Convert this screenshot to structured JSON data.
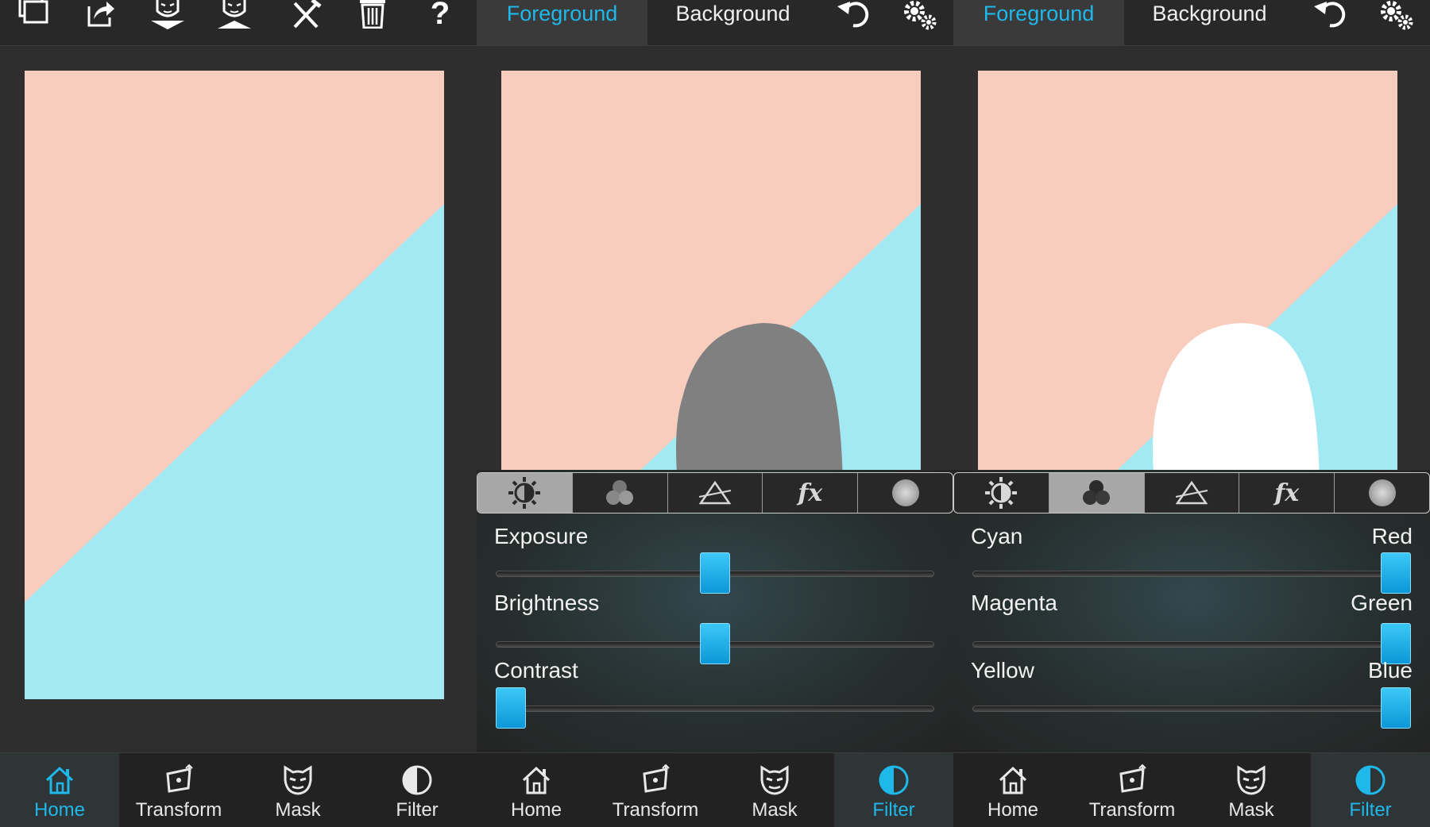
{
  "colors": {
    "accent": "#1fb8ea",
    "canvas_peach": "#f8cdbe",
    "canvas_cyan": "#a3e9f4",
    "silhouette_gray": "#808080",
    "silhouette_white": "#ffffff"
  },
  "toolbar_icons": [
    "layers-icon",
    "share-icon",
    "import-face-icon",
    "export-face-icon",
    "tools-icon",
    "trash-icon",
    "help-icon"
  ],
  "help_glyph": "?",
  "panels": [
    {
      "nav": [
        {
          "label": "Home",
          "icon": "home-icon",
          "active": true
        },
        {
          "label": "Transform",
          "icon": "transform-icon",
          "active": false
        },
        {
          "label": "Mask",
          "icon": "mask-icon",
          "active": false
        },
        {
          "label": "Filter",
          "icon": "filter-icon",
          "active": false
        }
      ]
    },
    {
      "tabs": {
        "foreground": "Foreground",
        "background": "Background",
        "active": "foreground"
      },
      "filter_tabs": [
        "brightness-icon",
        "color-balance-icon",
        "prism-icon",
        "fx-icon",
        "circle-icon"
      ],
      "fx_label": "fx",
      "selected_filter_tab": 0,
      "sliders": [
        {
          "label": "Exposure",
          "value": 0.5
        },
        {
          "label": "Brightness",
          "value": 0.5
        },
        {
          "label": "Contrast",
          "value": 0.0
        }
      ],
      "nav": [
        {
          "label": "Home",
          "icon": "home-icon",
          "active": false
        },
        {
          "label": "Transform",
          "icon": "transform-icon",
          "active": false
        },
        {
          "label": "Mask",
          "icon": "mask-icon",
          "active": false
        },
        {
          "label": "Filter",
          "icon": "filter-icon",
          "active": true
        }
      ]
    },
    {
      "tabs": {
        "foreground": "Foreground",
        "background": "Background",
        "active": "foreground"
      },
      "filter_tabs": [
        "brightness-icon",
        "color-balance-icon",
        "prism-icon",
        "fx-icon",
        "circle-icon"
      ],
      "fx_label": "fx",
      "selected_filter_tab": 1,
      "sliders": [
        {
          "left": "Cyan",
          "right": "Red",
          "value": 1.0
        },
        {
          "left": "Magenta",
          "right": "Green",
          "value": 1.0
        },
        {
          "left": "Yellow",
          "right": "Blue",
          "value": 1.0
        }
      ],
      "nav": [
        {
          "label": "Home",
          "icon": "home-icon",
          "active": false
        },
        {
          "label": "Transform",
          "icon": "transform-icon",
          "active": false
        },
        {
          "label": "Mask",
          "icon": "mask-icon",
          "active": false
        },
        {
          "label": "Filter",
          "icon": "filter-icon",
          "active": true
        }
      ]
    }
  ]
}
